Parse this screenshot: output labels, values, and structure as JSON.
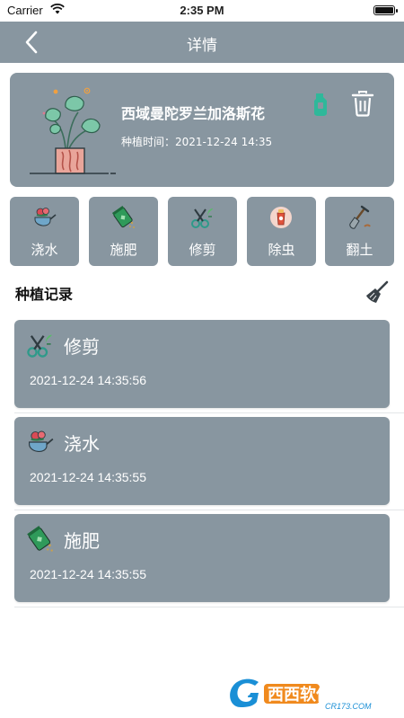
{
  "status_bar": {
    "carrier": "Carrier",
    "time": "2:35 PM"
  },
  "nav": {
    "title": "详情",
    "back_icon": "chevron-left-icon"
  },
  "plant": {
    "name": "西域曼陀罗兰加洛斯花",
    "date_label": "种植时间：",
    "date_value": "2021-12-24 14:35"
  },
  "actions": [
    {
      "label": "浇水",
      "icon": "watering-can-icon"
    },
    {
      "label": "施肥",
      "icon": "fertilizer-icon"
    },
    {
      "label": "修剪",
      "icon": "pruning-shears-icon"
    },
    {
      "label": "除虫",
      "icon": "pest-control-icon"
    },
    {
      "label": "翻土",
      "icon": "shovel-icon"
    }
  ],
  "records_section": {
    "title": "种植记录",
    "clear_icon": "broom-icon"
  },
  "records": [
    {
      "label": "修剪",
      "time": "2021-12-24 14:35:56",
      "icon": "pruning-shears-icon"
    },
    {
      "label": "浇水",
      "time": "2021-12-24 14:35:55",
      "icon": "watering-can-icon"
    },
    {
      "label": "施肥",
      "time": "2021-12-24 14:35:55",
      "icon": "fertilizer-icon"
    }
  ],
  "watermark": {
    "text": "西西软件园",
    "url": "CR173.COM"
  },
  "colors": {
    "card": "#8896a0",
    "text_on_card": "#ffffff",
    "accent_green": "#2fb89a"
  }
}
